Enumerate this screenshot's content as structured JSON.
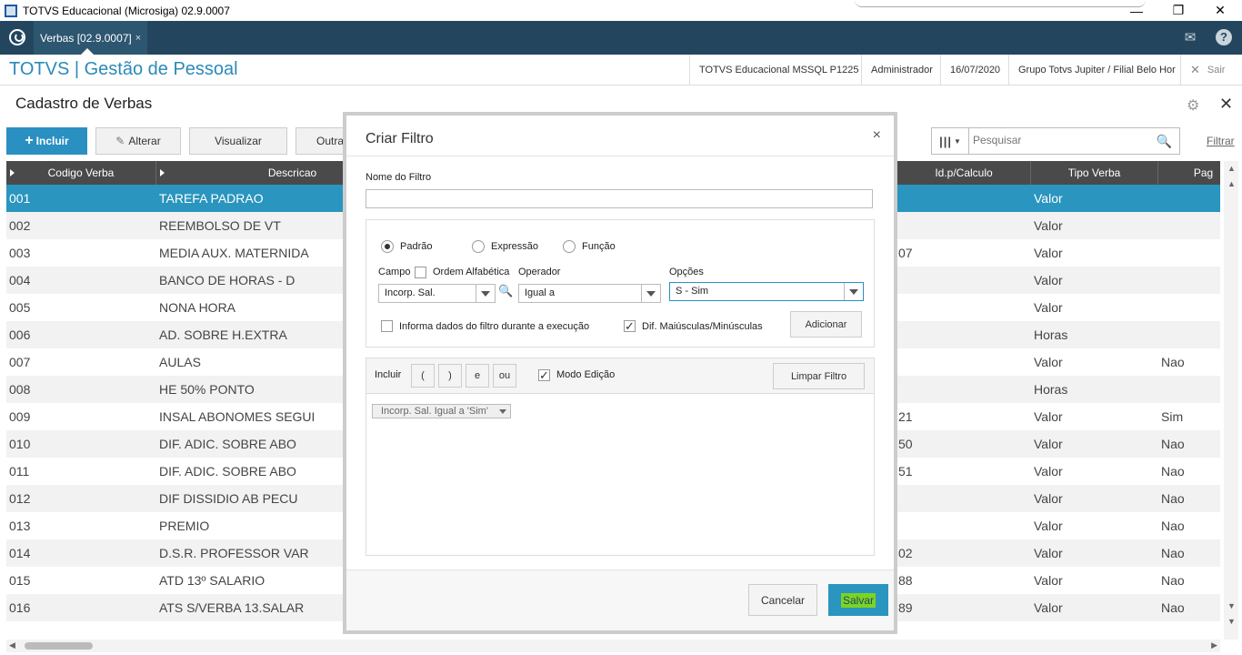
{
  "window": {
    "title": "TOTVS Educacional (Microsiga) 02.9.0007"
  },
  "topbar": {
    "tab_label": "Verbas [02.9.0007]",
    "tab_close": "×"
  },
  "header": {
    "app_title": "TOTVS | Gestão de Pessoal",
    "environment": "TOTVS Educacional MSSQL P1225",
    "user": "Administrador",
    "date": "16/07/2020",
    "company": "Grupo Totvs Jupiter / Filial Belo Hor",
    "exit_label": "Sair"
  },
  "page": {
    "title": "Cadastro de Verbas"
  },
  "toolbar": {
    "incluir": "Incluir",
    "alterar": "Alterar",
    "visualizar": "Visualizar",
    "outras": "Outras",
    "search_placeholder": "Pesquisar",
    "filtrar": "Filtrar"
  },
  "grid": {
    "columns": [
      "Codigo Verba",
      "Descricao",
      "Id.p/Calculo",
      "Tipo Verba",
      "Pag"
    ],
    "rows": [
      {
        "code": "001",
        "desc": "TAREFA PADRAO",
        "calc": "",
        "tipo": "Valor",
        "pag": ""
      },
      {
        "code": "002",
        "desc": "REEMBOLSO DE VT",
        "calc": "",
        "tipo": "Valor",
        "pag": ""
      },
      {
        "code": "003",
        "desc": "MEDIA AUX. MATERNIDA",
        "calc": "07",
        "tipo": "Valor",
        "pag": ""
      },
      {
        "code": "004",
        "desc": "BANCO DE HORAS - D",
        "calc": "",
        "tipo": "Valor",
        "pag": ""
      },
      {
        "code": "005",
        "desc": "NONA HORA",
        "calc": "",
        "tipo": "Valor",
        "pag": ""
      },
      {
        "code": "006",
        "desc": "AD. SOBRE H.EXTRA",
        "calc": "",
        "tipo": "Horas",
        "pag": ""
      },
      {
        "code": "007",
        "desc": "AULAS",
        "calc": "",
        "tipo": "Valor",
        "pag": "Nao"
      },
      {
        "code": "008",
        "desc": "HE 50% PONTO",
        "calc": "",
        "tipo": "Horas",
        "pag": ""
      },
      {
        "code": "009",
        "desc": "INSAL ABONOMES SEGUI",
        "calc": "21",
        "tipo": "Valor",
        "pag": "Sim"
      },
      {
        "code": "010",
        "desc": "DIF. ADIC. SOBRE ABO",
        "calc": "50",
        "tipo": "Valor",
        "pag": "Nao"
      },
      {
        "code": "011",
        "desc": "DIF. ADIC. SOBRE ABO",
        "calc": "51",
        "tipo": "Valor",
        "pag": "Nao"
      },
      {
        "code": "012",
        "desc": "DIF DISSIDIO AB PECU",
        "calc": "",
        "tipo": "Valor",
        "pag": "Nao"
      },
      {
        "code": "013",
        "desc": "PREMIO",
        "calc": "",
        "tipo": "Valor",
        "pag": "Nao"
      },
      {
        "code": "014",
        "desc": "D.S.R. PROFESSOR VAR",
        "calc": "02",
        "tipo": "Valor",
        "pag": "Nao"
      },
      {
        "code": "015",
        "desc": "ATD 13º SALARIO",
        "calc": "88",
        "tipo": "Valor",
        "pag": "Nao"
      },
      {
        "code": "016",
        "desc": "ATS S/VERBA 13.SALAR",
        "calc": "89",
        "tipo": "Valor",
        "pag": "Nao"
      }
    ]
  },
  "dialog": {
    "title": "Criar Filtro",
    "close": "×",
    "nome_label": "Nome do Filtro",
    "nome_value": "",
    "radio_padrao": "Padrão",
    "radio_expressao": "Expressão",
    "radio_funcao": "Função",
    "campo_label": "Campo",
    "ordem_label": "Ordem Alfabética",
    "operador_label": "Operador",
    "opcoes_label": "Opções",
    "campo_value": "Incorp. Sal.",
    "operador_value": "Igual a",
    "opcoes_value": "S - Sim",
    "informa_label": "Informa dados do filtro durante a execução",
    "dif_label": "Dif. Maiúsculas/Minúsculas",
    "adicionar": "Adicionar",
    "incluir_label": "Incluir",
    "op_open": "(",
    "op_close": ")",
    "op_e": "e",
    "op_ou": "ou",
    "modo_label": "Modo Edição",
    "limpar": "Limpar Filtro",
    "expression": "Incorp. Sal. Igual a 'Sim'",
    "cancelar": "Cancelar",
    "salvar": "Salvar"
  }
}
